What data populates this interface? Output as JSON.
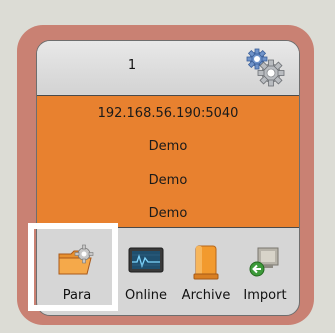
{
  "card": {
    "number": "1",
    "info": {
      "address": "192.168.56.190:5040",
      "line_2": "Demo",
      "line_3": "Demo",
      "line_4": "Demo"
    },
    "settings_icon": "gear-icon"
  },
  "toolbar": {
    "items": [
      {
        "label": "Para",
        "icon": "folder-gear-icon"
      },
      {
        "label": "Online",
        "icon": "monitor-icon"
      },
      {
        "label": "Archive",
        "icon": "archive-icon"
      },
      {
        "label": "Import",
        "icon": "import-icon"
      }
    ]
  },
  "colors": {
    "frame": "#c98173",
    "info_panel": "#e8812f",
    "highlight": "#ffffff",
    "background": "#dcdcd5"
  }
}
